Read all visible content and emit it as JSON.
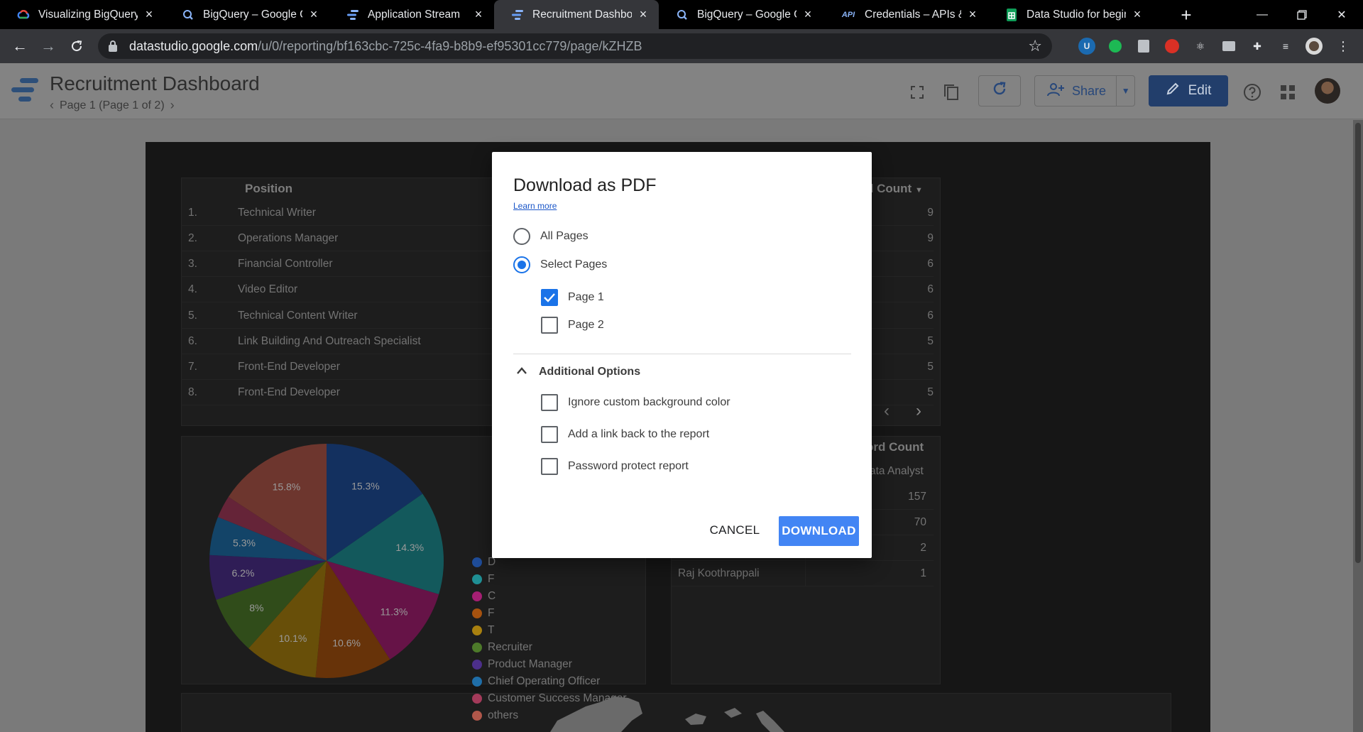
{
  "browser": {
    "tabs": [
      {
        "title": "Visualizing BigQuery da",
        "icon": "google-cloud-icon",
        "active": false
      },
      {
        "title": "BigQuery – Google Clo",
        "icon": "bigquery-icon",
        "active": false
      },
      {
        "title": "Application Stream",
        "icon": "data-studio-icon",
        "active": false
      },
      {
        "title": "Recruitment Dashboar",
        "icon": "data-studio-icon",
        "active": true
      },
      {
        "title": "BigQuery – Google Clo",
        "icon": "bigquery-icon",
        "active": false
      },
      {
        "title": "Credentials – APIs & Se",
        "icon": "api-icon",
        "active": false
      },
      {
        "title": "Data Studio for beginn",
        "icon": "sheets-icon",
        "active": false
      }
    ],
    "url_host": "datastudio.google.com",
    "url_path": "/u/0/reporting/bf163cbc-725c-4fa9-b8b9-ef95301cc779/page/kZHZB",
    "api_icon_text": "API"
  },
  "header": {
    "title": "Recruitment Dashboard",
    "pager": "Page 1 (Page 1 of 2)",
    "share_label": "Share",
    "edit_label": "Edit"
  },
  "report": {
    "table": {
      "col_position": "Position",
      "col_count": "d Count",
      "rows": [
        {
          "idx": "1.",
          "position": "Technical Writer",
          "count": "9"
        },
        {
          "idx": "2.",
          "position": "Operations Manager",
          "count": "9"
        },
        {
          "idx": "3.",
          "position": "Financial Controller",
          "count": "6"
        },
        {
          "idx": "4.",
          "position": "Video Editor",
          "count": "6"
        },
        {
          "idx": "5.",
          "position": "Technical Content Writer",
          "count": "6"
        },
        {
          "idx": "6.",
          "position": "Link Building And Outreach Specialist",
          "count": "5"
        },
        {
          "idx": "7.",
          "position": "Front-End Developer",
          "count": "5"
        },
        {
          "idx": "8.",
          "position": "Front-End Developer",
          "count": "5"
        }
      ]
    },
    "pie": {
      "labels_shown": [
        "15.3%",
        "14.3%",
        "11.3%",
        "10.6%",
        "10.1%",
        "8%",
        "6.2%",
        "5.3%",
        "15.8%"
      ],
      "legend": [
        "D",
        "F",
        "C",
        "F",
        "T",
        "Recruiter",
        "Product Manager",
        "Chief Operating Officer",
        "Customer Success Manager",
        "others"
      ],
      "colors": [
        "#1f4d9a",
        "#1f8f94",
        "#a51f73",
        "#a6520f",
        "#a8800f",
        "#4d7a2a",
        "#4c2f8a",
        "#1f6ea8",
        "#a33a5a",
        "#b0574a"
      ]
    },
    "record_table": {
      "title": "ord Count",
      "subheader": "ata Analyst",
      "rows": [
        {
          "name": "",
          "value": "157"
        },
        {
          "name": "",
          "value": "70"
        },
        {
          "name": "",
          "value": "2"
        },
        {
          "name": "Raj Koothrappali",
          "value": "1"
        }
      ]
    }
  },
  "modal": {
    "title": "Download as PDF",
    "learn_more": "Learn more",
    "radio_all": "All Pages",
    "radio_select": "Select Pages",
    "page1": "Page 1",
    "page2": "Page 2",
    "additional_options": "Additional Options",
    "opt_ignore_bg": "Ignore custom background color",
    "opt_link_back": "Add a link back to the report",
    "opt_password": "Password protect report",
    "cancel_label": "CANCEL",
    "download_label": "DOWNLOAD"
  }
}
